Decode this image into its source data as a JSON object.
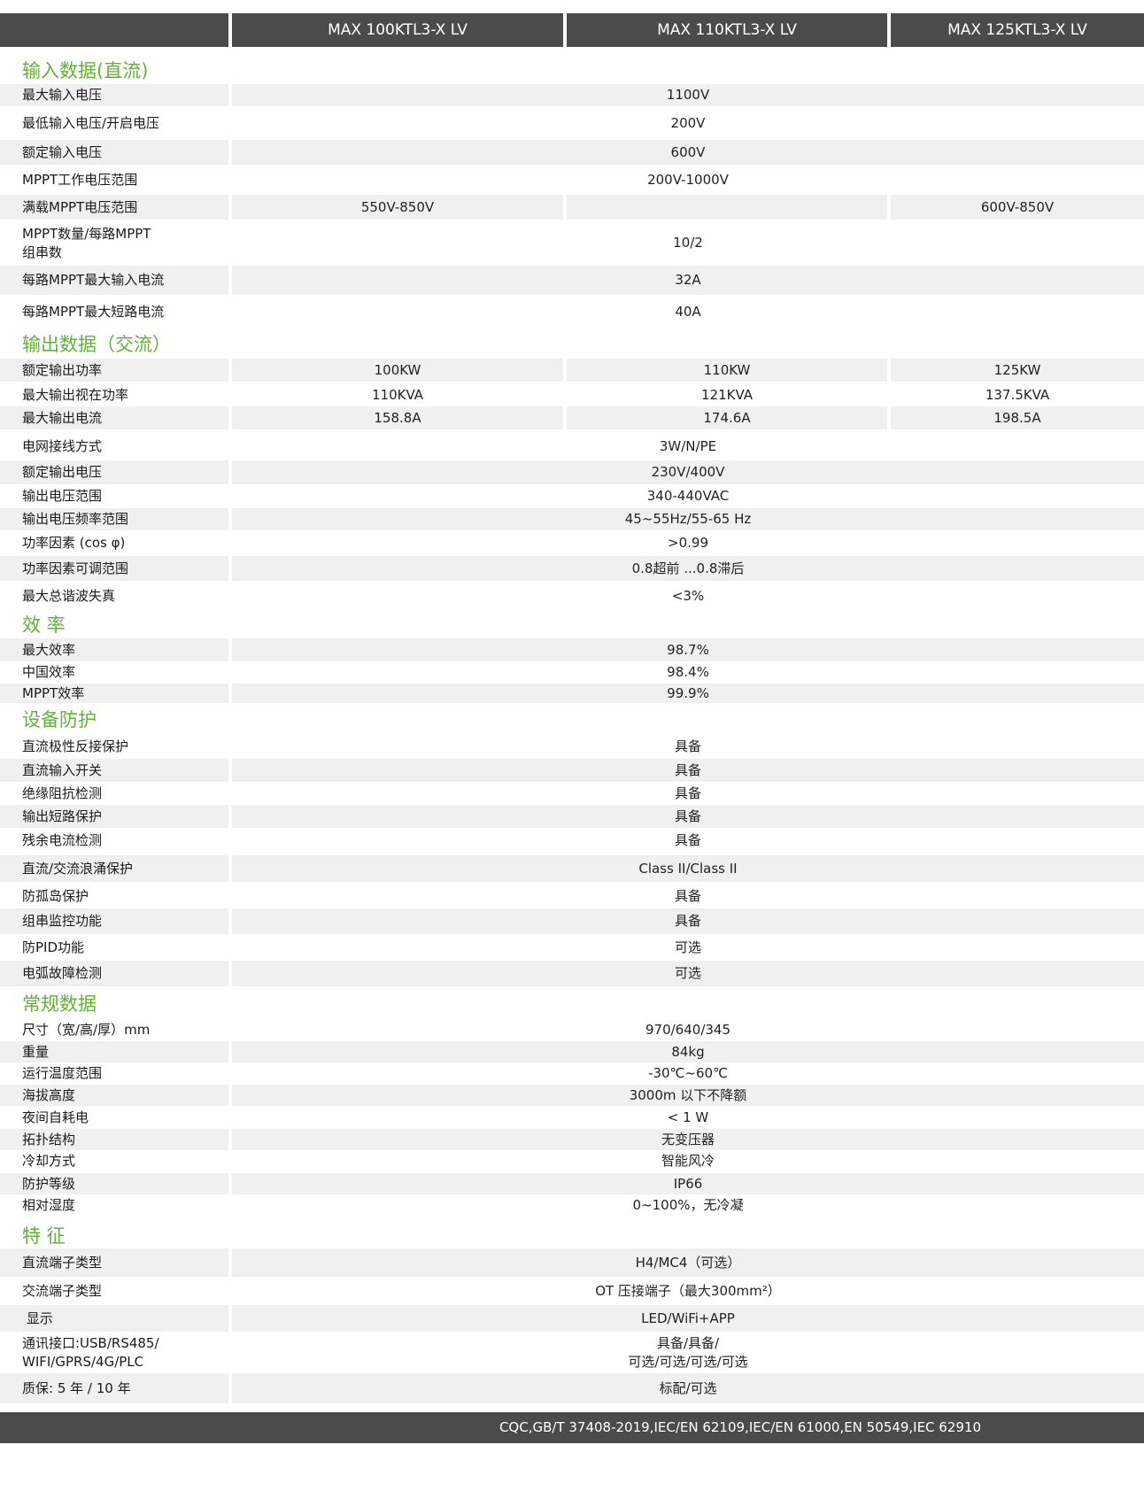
{
  "header": {
    "models": [
      "MAX 100KTL3-X LV",
      "MAX 110KTL3-X LV",
      "MAX 125KTL3-X LV"
    ]
  },
  "sections": [
    {
      "title": "输入数据(直流)",
      "rows": [
        {
          "label": "最大输入电压",
          "values": [
            "1100V"
          ]
        },
        {
          "label": "最低输入电压/开启电压",
          "values": [
            "200V"
          ]
        },
        {
          "label": "额定输入电压",
          "values": [
            "600V"
          ]
        },
        {
          "label": "MPPT工作电压范围",
          "values": [
            "200V-1000V"
          ]
        },
        {
          "label": "满载MPPT电压范围",
          "values": [
            "550V-850V",
            "",
            "600V-850V"
          ]
        },
        {
          "label": "MPPT数量/每路MPPT\n组串数",
          "values": [
            "10/2"
          ]
        },
        {
          "label": "每路MPPT最大输入电流",
          "values": [
            "32A"
          ]
        },
        {
          "label": "每路MPPT最大短路电流",
          "values": [
            "40A"
          ]
        }
      ]
    },
    {
      "title": "输出数据（交流）",
      "rows": [
        {
          "label": "额定输出功率",
          "values": [
            "100KW",
            "110KW",
            "125KW"
          ]
        },
        {
          "label": "最大输出视在功率",
          "values": [
            "110KVA",
            "121KVA",
            "137.5KVA"
          ]
        },
        {
          "label": "最大输出电流",
          "values": [
            "158.8A",
            "174.6A",
            "198.5A"
          ]
        },
        {
          "label": "电网接线方式",
          "values": [
            "3W/N/PE"
          ]
        },
        {
          "label": "额定输出电压",
          "values": [
            "230V/400V"
          ]
        },
        {
          "label": "输出电压范围",
          "values": [
            "340-440VAC"
          ]
        },
        {
          "label": "输出电压频率范围",
          "values": [
            "45~55Hz/55-65 Hz"
          ]
        },
        {
          "label": "功率因素 (cos φ)",
          "values": [
            ">0.99"
          ]
        },
        {
          "label": "功率因素可调范围",
          "values": [
            "0.8超前 ...0.8滞后"
          ]
        },
        {
          "label": "最大总谐波失真",
          "values": [
            "<3%"
          ]
        }
      ]
    },
    {
      "title": "效  率",
      "rows": [
        {
          "label": "最大效率",
          "values": [
            "98.7%"
          ]
        },
        {
          "label": "中国效率",
          "values": [
            "98.4%"
          ]
        },
        {
          "label": "MPPT效率",
          "values": [
            "99.9%"
          ]
        }
      ]
    },
    {
      "title": "设备防护",
      "rows": [
        {
          "label": "直流极性反接保护",
          "values": [
            "具备"
          ]
        },
        {
          "label": "直流输入开关",
          "values": [
            "具备"
          ]
        },
        {
          "label": "绝缘阻抗检测",
          "values": [
            "具备"
          ]
        },
        {
          "label": "输出短路保护",
          "values": [
            "具备"
          ]
        },
        {
          "label": "残余电流检测",
          "values": [
            "具备"
          ]
        },
        {
          "label": "直流/交流浪涌保护",
          "values": [
            "Class II/Class II"
          ]
        },
        {
          "label": "防孤岛保护",
          "values": [
            "具备"
          ]
        },
        {
          "label": "组串监控功能",
          "values": [
            "具备"
          ]
        },
        {
          "label": "防PID功能",
          "values": [
            "可选"
          ]
        },
        {
          "label": "电弧故障检测",
          "values": [
            "可选"
          ]
        }
      ]
    },
    {
      "title": "常规数据",
      "rows": [
        {
          "label": "尺寸（宽/高/厚）mm",
          "values": [
            "970/640/345"
          ]
        },
        {
          "label": "重量",
          "values": [
            "84kg"
          ]
        },
        {
          "label": "运行温度范围",
          "values": [
            "-30℃~60℃"
          ]
        },
        {
          "label": "海拔高度",
          "values": [
            "3000m 以下不降额"
          ]
        },
        {
          "label": "夜间自耗电",
          "values": [
            "< 1 W"
          ]
        },
        {
          "label": "拓扑结构",
          "values": [
            "无变压器"
          ]
        },
        {
          "label": "冷却方式",
          "values": [
            "智能风冷"
          ]
        },
        {
          "label": "防护等级",
          "values": [
            "IP66"
          ]
        },
        {
          "label": "相对湿度",
          "values": [
            "0~100%，无冷凝"
          ]
        }
      ]
    },
    {
      "title": "特  征",
      "rows": [
        {
          "label": "直流端子类型",
          "values": [
            "H4/MC4（可选）"
          ]
        },
        {
          "label": "交流端子类型",
          "values": [
            "OT 压接端子（最大300mm²）"
          ]
        },
        {
          "label": " 显示",
          "values": [
            "LED/WiFi+APP"
          ]
        },
        {
          "label": "通讯接口:USB/RS485/\nWIFI/GPRS/4G/PLC",
          "values": [
            "具备/具备/\n可选/可选/可选/可选"
          ]
        },
        {
          "label": "质保: 5 年 / 10 年",
          "values": [
            "标配/可选"
          ]
        }
      ]
    }
  ],
  "footer": {
    "certifications": "CQC,GB/T 37408-2019,IEC/EN 62109,IEC/EN 61000,EN 50549,IEC 62910"
  }
}
